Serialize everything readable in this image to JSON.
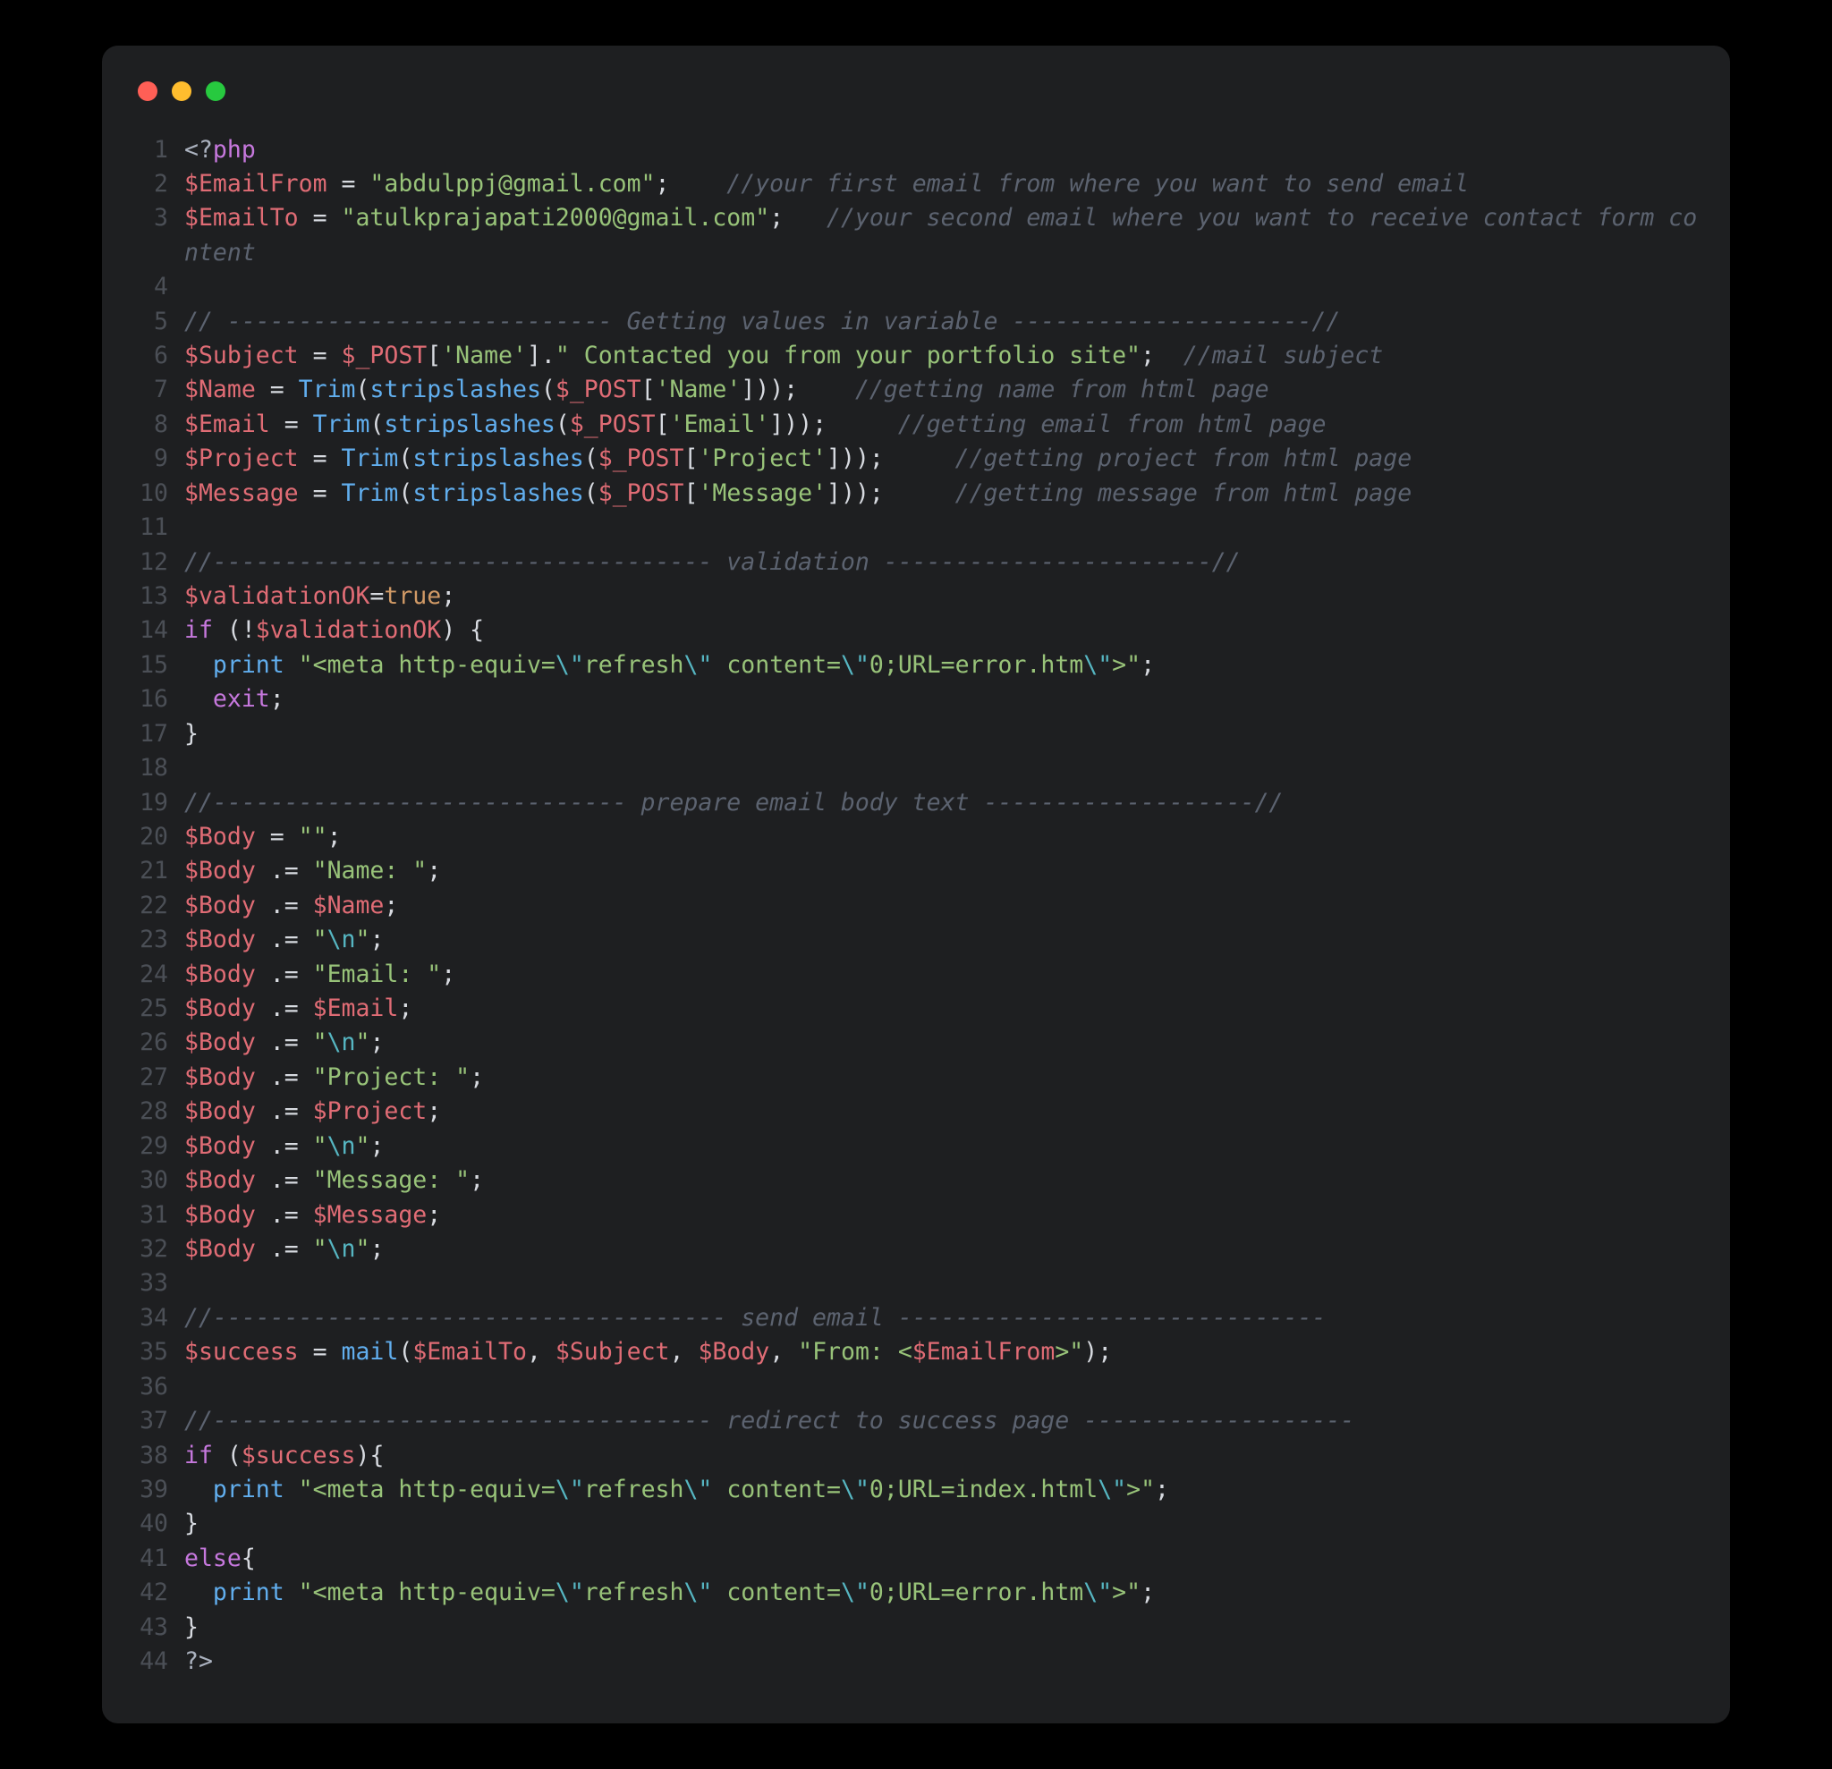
{
  "window": {
    "traffic_light_colors": {
      "close": "#ff5f56",
      "minimize": "#ffbd2e",
      "zoom": "#27c93f"
    }
  },
  "code": {
    "language": "php",
    "lines": [
      {
        "n": 1,
        "tokens": [
          {
            "t": "<?",
            "c": "gr"
          },
          {
            "t": "php",
            "c": "p"
          }
        ]
      },
      {
        "n": 2,
        "tokens": [
          {
            "t": "$EmailFrom",
            "c": "r"
          },
          {
            "t": " = ",
            "c": "w"
          },
          {
            "t": "\"abdulppj@gmail.com\"",
            "c": "g"
          },
          {
            "t": ";    ",
            "c": "w"
          },
          {
            "t": "//your first email from where you want to send email",
            "c": "c"
          }
        ]
      },
      {
        "n": 3,
        "tokens": [
          {
            "t": "$EmailTo",
            "c": "r"
          },
          {
            "t": " = ",
            "c": "w"
          },
          {
            "t": "\"atulkprajapati2000@gmail.com\"",
            "c": "g"
          },
          {
            "t": ";   ",
            "c": "w"
          },
          {
            "t": "//your second email where you want to receive contact form content",
            "c": "c"
          }
        ]
      },
      {
        "n": 4,
        "tokens": [
          {
            "t": "",
            "c": "w"
          }
        ]
      },
      {
        "n": 5,
        "tokens": [
          {
            "t": "// --------------------------- Getting values in variable ---------------------//",
            "c": "c"
          }
        ]
      },
      {
        "n": 6,
        "tokens": [
          {
            "t": "$Subject",
            "c": "r"
          },
          {
            "t": " = ",
            "c": "w"
          },
          {
            "t": "$_POST",
            "c": "r"
          },
          {
            "t": "[",
            "c": "w"
          },
          {
            "t": "'Name'",
            "c": "g"
          },
          {
            "t": "].",
            "c": "w"
          },
          {
            "t": "\" Contacted you from your portfolio site\"",
            "c": "g"
          },
          {
            "t": ";  ",
            "c": "w"
          },
          {
            "t": "//mail subject",
            "c": "c"
          }
        ]
      },
      {
        "n": 7,
        "tokens": [
          {
            "t": "$Name",
            "c": "r"
          },
          {
            "t": " = ",
            "c": "w"
          },
          {
            "t": "Trim",
            "c": "b"
          },
          {
            "t": "(",
            "c": "w"
          },
          {
            "t": "stripslashes",
            "c": "b"
          },
          {
            "t": "(",
            "c": "w"
          },
          {
            "t": "$_POST",
            "c": "r"
          },
          {
            "t": "[",
            "c": "w"
          },
          {
            "t": "'Name'",
            "c": "g"
          },
          {
            "t": "]));    ",
            "c": "w"
          },
          {
            "t": "//getting name from html page",
            "c": "c"
          }
        ]
      },
      {
        "n": 8,
        "tokens": [
          {
            "t": "$Email",
            "c": "r"
          },
          {
            "t": " = ",
            "c": "w"
          },
          {
            "t": "Trim",
            "c": "b"
          },
          {
            "t": "(",
            "c": "w"
          },
          {
            "t": "stripslashes",
            "c": "b"
          },
          {
            "t": "(",
            "c": "w"
          },
          {
            "t": "$_POST",
            "c": "r"
          },
          {
            "t": "[",
            "c": "w"
          },
          {
            "t": "'Email'",
            "c": "g"
          },
          {
            "t": "]));     ",
            "c": "w"
          },
          {
            "t": "//getting email from html page",
            "c": "c"
          }
        ]
      },
      {
        "n": 9,
        "tokens": [
          {
            "t": "$Project",
            "c": "r"
          },
          {
            "t": " = ",
            "c": "w"
          },
          {
            "t": "Trim",
            "c": "b"
          },
          {
            "t": "(",
            "c": "w"
          },
          {
            "t": "stripslashes",
            "c": "b"
          },
          {
            "t": "(",
            "c": "w"
          },
          {
            "t": "$_POST",
            "c": "r"
          },
          {
            "t": "[",
            "c": "w"
          },
          {
            "t": "'Project'",
            "c": "g"
          },
          {
            "t": "]));     ",
            "c": "w"
          },
          {
            "t": "//getting project from html page",
            "c": "c"
          }
        ]
      },
      {
        "n": 10,
        "tokens": [
          {
            "t": "$Message",
            "c": "r"
          },
          {
            "t": " = ",
            "c": "w"
          },
          {
            "t": "Trim",
            "c": "b"
          },
          {
            "t": "(",
            "c": "w"
          },
          {
            "t": "stripslashes",
            "c": "b"
          },
          {
            "t": "(",
            "c": "w"
          },
          {
            "t": "$_POST",
            "c": "r"
          },
          {
            "t": "[",
            "c": "w"
          },
          {
            "t": "'Message'",
            "c": "g"
          },
          {
            "t": "]));     ",
            "c": "w"
          },
          {
            "t": "//getting message from html page",
            "c": "c"
          }
        ]
      },
      {
        "n": 11,
        "tokens": [
          {
            "t": "",
            "c": "w"
          }
        ]
      },
      {
        "n": 12,
        "tokens": [
          {
            "t": "//----------------------------------- validation -----------------------//",
            "c": "c"
          }
        ]
      },
      {
        "n": 13,
        "tokens": [
          {
            "t": "$validationOK",
            "c": "r"
          },
          {
            "t": "=",
            "c": "w"
          },
          {
            "t": "true",
            "c": "o"
          },
          {
            "t": ";",
            "c": "w"
          }
        ]
      },
      {
        "n": 14,
        "tokens": [
          {
            "t": "if",
            "c": "p"
          },
          {
            "t": " (!",
            "c": "w"
          },
          {
            "t": "$validationOK",
            "c": "r"
          },
          {
            "t": ") {",
            "c": "w"
          }
        ]
      },
      {
        "n": 15,
        "tokens": [
          {
            "t": "  ",
            "c": "w"
          },
          {
            "t": "print",
            "c": "b"
          },
          {
            "t": " ",
            "c": "w"
          },
          {
            "t": "\"<meta http-equiv=",
            "c": "g"
          },
          {
            "t": "\\\"",
            "c": "cy"
          },
          {
            "t": "refresh",
            "c": "g"
          },
          {
            "t": "\\\"",
            "c": "cy"
          },
          {
            "t": " content=",
            "c": "g"
          },
          {
            "t": "\\\"",
            "c": "cy"
          },
          {
            "t": "0;URL=error.htm",
            "c": "g"
          },
          {
            "t": "\\\"",
            "c": "cy"
          },
          {
            "t": ">\"",
            "c": "g"
          },
          {
            "t": ";",
            "c": "w"
          }
        ]
      },
      {
        "n": 16,
        "tokens": [
          {
            "t": "  ",
            "c": "w"
          },
          {
            "t": "exit",
            "c": "p"
          },
          {
            "t": ";",
            "c": "w"
          }
        ]
      },
      {
        "n": 17,
        "tokens": [
          {
            "t": "}",
            "c": "w"
          }
        ]
      },
      {
        "n": 18,
        "tokens": [
          {
            "t": "",
            "c": "w"
          }
        ]
      },
      {
        "n": 19,
        "tokens": [
          {
            "t": "//----------------------------- prepare email body text -------------------//",
            "c": "c"
          }
        ]
      },
      {
        "n": 20,
        "tokens": [
          {
            "t": "$Body",
            "c": "r"
          },
          {
            "t": " = ",
            "c": "w"
          },
          {
            "t": "\"\"",
            "c": "g"
          },
          {
            "t": ";",
            "c": "w"
          }
        ]
      },
      {
        "n": 21,
        "tokens": [
          {
            "t": "$Body",
            "c": "r"
          },
          {
            "t": " .= ",
            "c": "w"
          },
          {
            "t": "\"Name: \"",
            "c": "g"
          },
          {
            "t": ";",
            "c": "w"
          }
        ]
      },
      {
        "n": 22,
        "tokens": [
          {
            "t": "$Body",
            "c": "r"
          },
          {
            "t": " .= ",
            "c": "w"
          },
          {
            "t": "$Name",
            "c": "r"
          },
          {
            "t": ";",
            "c": "w"
          }
        ]
      },
      {
        "n": 23,
        "tokens": [
          {
            "t": "$Body",
            "c": "r"
          },
          {
            "t": " .= ",
            "c": "w"
          },
          {
            "t": "\"",
            "c": "g"
          },
          {
            "t": "\\n",
            "c": "cy"
          },
          {
            "t": "\"",
            "c": "g"
          },
          {
            "t": ";",
            "c": "w"
          }
        ]
      },
      {
        "n": 24,
        "tokens": [
          {
            "t": "$Body",
            "c": "r"
          },
          {
            "t": " .= ",
            "c": "w"
          },
          {
            "t": "\"Email: \"",
            "c": "g"
          },
          {
            "t": ";",
            "c": "w"
          }
        ]
      },
      {
        "n": 25,
        "tokens": [
          {
            "t": "$Body",
            "c": "r"
          },
          {
            "t": " .= ",
            "c": "w"
          },
          {
            "t": "$Email",
            "c": "r"
          },
          {
            "t": ";",
            "c": "w"
          }
        ]
      },
      {
        "n": 26,
        "tokens": [
          {
            "t": "$Body",
            "c": "r"
          },
          {
            "t": " .= ",
            "c": "w"
          },
          {
            "t": "\"",
            "c": "g"
          },
          {
            "t": "\\n",
            "c": "cy"
          },
          {
            "t": "\"",
            "c": "g"
          },
          {
            "t": ";",
            "c": "w"
          }
        ]
      },
      {
        "n": 27,
        "tokens": [
          {
            "t": "$Body",
            "c": "r"
          },
          {
            "t": " .= ",
            "c": "w"
          },
          {
            "t": "\"Project: \"",
            "c": "g"
          },
          {
            "t": ";",
            "c": "w"
          }
        ]
      },
      {
        "n": 28,
        "tokens": [
          {
            "t": "$Body",
            "c": "r"
          },
          {
            "t": " .= ",
            "c": "w"
          },
          {
            "t": "$Project",
            "c": "r"
          },
          {
            "t": ";",
            "c": "w"
          }
        ]
      },
      {
        "n": 29,
        "tokens": [
          {
            "t": "$Body",
            "c": "r"
          },
          {
            "t": " .= ",
            "c": "w"
          },
          {
            "t": "\"",
            "c": "g"
          },
          {
            "t": "\\n",
            "c": "cy"
          },
          {
            "t": "\"",
            "c": "g"
          },
          {
            "t": ";",
            "c": "w"
          }
        ]
      },
      {
        "n": 30,
        "tokens": [
          {
            "t": "$Body",
            "c": "r"
          },
          {
            "t": " .= ",
            "c": "w"
          },
          {
            "t": "\"Message: \"",
            "c": "g"
          },
          {
            "t": ";",
            "c": "w"
          }
        ]
      },
      {
        "n": 31,
        "tokens": [
          {
            "t": "$Body",
            "c": "r"
          },
          {
            "t": " .= ",
            "c": "w"
          },
          {
            "t": "$Message",
            "c": "r"
          },
          {
            "t": ";",
            "c": "w"
          }
        ]
      },
      {
        "n": 32,
        "tokens": [
          {
            "t": "$Body",
            "c": "r"
          },
          {
            "t": " .= ",
            "c": "w"
          },
          {
            "t": "\"",
            "c": "g"
          },
          {
            "t": "\\n",
            "c": "cy"
          },
          {
            "t": "\"",
            "c": "g"
          },
          {
            "t": ";",
            "c": "w"
          }
        ]
      },
      {
        "n": 33,
        "tokens": [
          {
            "t": "",
            "c": "w"
          }
        ]
      },
      {
        "n": 34,
        "tokens": [
          {
            "t": "//------------------------------------ send email ------------------------------",
            "c": "c"
          }
        ]
      },
      {
        "n": 35,
        "tokens": [
          {
            "t": "$success",
            "c": "r"
          },
          {
            "t": " = ",
            "c": "w"
          },
          {
            "t": "mail",
            "c": "b"
          },
          {
            "t": "(",
            "c": "w"
          },
          {
            "t": "$EmailTo",
            "c": "r"
          },
          {
            "t": ", ",
            "c": "w"
          },
          {
            "t": "$Subject",
            "c": "r"
          },
          {
            "t": ", ",
            "c": "w"
          },
          {
            "t": "$Body",
            "c": "r"
          },
          {
            "t": ", ",
            "c": "w"
          },
          {
            "t": "\"From: <",
            "c": "g"
          },
          {
            "t": "$EmailFrom",
            "c": "r"
          },
          {
            "t": ">\"",
            "c": "g"
          },
          {
            "t": ");",
            "c": "w"
          }
        ]
      },
      {
        "n": 36,
        "tokens": [
          {
            "t": "",
            "c": "w"
          }
        ]
      },
      {
        "n": 37,
        "tokens": [
          {
            "t": "//----------------------------------- redirect to success page -------------------",
            "c": "c"
          }
        ]
      },
      {
        "n": 38,
        "tokens": [
          {
            "t": "if",
            "c": "p"
          },
          {
            "t": " (",
            "c": "w"
          },
          {
            "t": "$success",
            "c": "r"
          },
          {
            "t": "){",
            "c": "w"
          }
        ]
      },
      {
        "n": 39,
        "tokens": [
          {
            "t": "  ",
            "c": "w"
          },
          {
            "t": "print",
            "c": "b"
          },
          {
            "t": " ",
            "c": "w"
          },
          {
            "t": "\"<meta http-equiv=",
            "c": "g"
          },
          {
            "t": "\\\"",
            "c": "cy"
          },
          {
            "t": "refresh",
            "c": "g"
          },
          {
            "t": "\\\"",
            "c": "cy"
          },
          {
            "t": " content=",
            "c": "g"
          },
          {
            "t": "\\\"",
            "c": "cy"
          },
          {
            "t": "0;URL=index.html",
            "c": "g"
          },
          {
            "t": "\\\"",
            "c": "cy"
          },
          {
            "t": ">\"",
            "c": "g"
          },
          {
            "t": ";",
            "c": "w"
          }
        ]
      },
      {
        "n": 40,
        "tokens": [
          {
            "t": "}",
            "c": "w"
          }
        ]
      },
      {
        "n": 41,
        "tokens": [
          {
            "t": "else",
            "c": "p"
          },
          {
            "t": "{",
            "c": "w"
          }
        ]
      },
      {
        "n": 42,
        "tokens": [
          {
            "t": "  ",
            "c": "w"
          },
          {
            "t": "print",
            "c": "b"
          },
          {
            "t": " ",
            "c": "w"
          },
          {
            "t": "\"<meta http-equiv=",
            "c": "g"
          },
          {
            "t": "\\\"",
            "c": "cy"
          },
          {
            "t": "refresh",
            "c": "g"
          },
          {
            "t": "\\\"",
            "c": "cy"
          },
          {
            "t": " content=",
            "c": "g"
          },
          {
            "t": "\\\"",
            "c": "cy"
          },
          {
            "t": "0;URL=error.htm",
            "c": "g"
          },
          {
            "t": "\\\"",
            "c": "cy"
          },
          {
            "t": ">\"",
            "c": "g"
          },
          {
            "t": ";",
            "c": "w"
          }
        ]
      },
      {
        "n": 43,
        "tokens": [
          {
            "t": "}",
            "c": "w"
          }
        ]
      },
      {
        "n": 44,
        "tokens": [
          {
            "t": "?>",
            "c": "gr"
          }
        ]
      }
    ]
  }
}
